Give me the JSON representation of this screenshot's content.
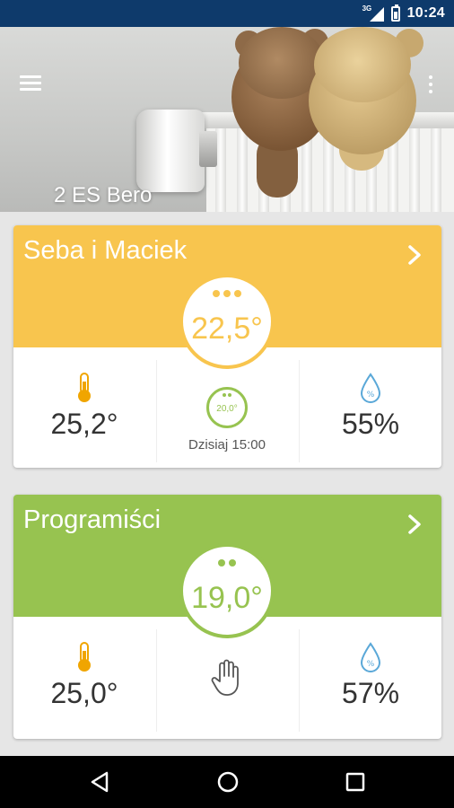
{
  "status_bar": {
    "network": "3G",
    "time": "10:24"
  },
  "header": {
    "title": "2 ES Bero"
  },
  "colors": {
    "yellow": "#f8c54e",
    "green": "#97c350",
    "orange": "#f0a500",
    "blue": "#5aa8d8"
  },
  "rooms": [
    {
      "name": "Seba i Maciek",
      "setpoint": "22,5°",
      "temperature": "25,2°",
      "humidity": "55%",
      "mode_temp": "20,0°",
      "schedule": "Dzisiaj 15:00"
    },
    {
      "name": "Programiści",
      "setpoint": "19,0°",
      "temperature": "25,0°",
      "humidity": "57%"
    }
  ],
  "icons": [
    "menu-icon",
    "more-vert-icon",
    "chevron-right-icon",
    "thermometer-icon",
    "humidity-drop-icon",
    "hand-manual-icon",
    "back-icon",
    "home-icon",
    "recents-icon"
  ]
}
